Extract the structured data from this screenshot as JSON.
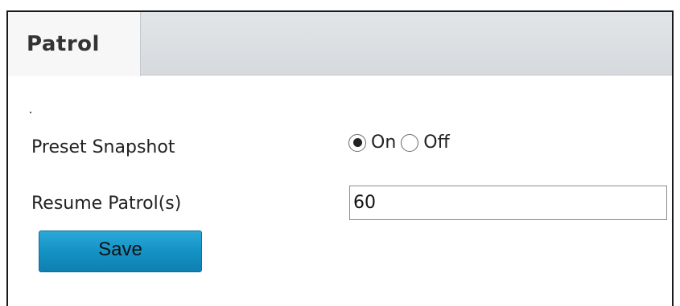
{
  "tab": {
    "label": "Patrol"
  },
  "form": {
    "preset_snapshot": {
      "label": "Preset Snapshot",
      "options": [
        {
          "label": "On",
          "selected": true
        },
        {
          "label": "Off",
          "selected": false
        }
      ]
    },
    "resume_patrol": {
      "label": "Resume Patrol(s)",
      "value": "60"
    }
  },
  "actions": {
    "save_label": "Save"
  },
  "colors": {
    "save_button": "#1592c4",
    "tab_active": "#f7f7f7",
    "tab_bar": "#dcdfe2"
  }
}
